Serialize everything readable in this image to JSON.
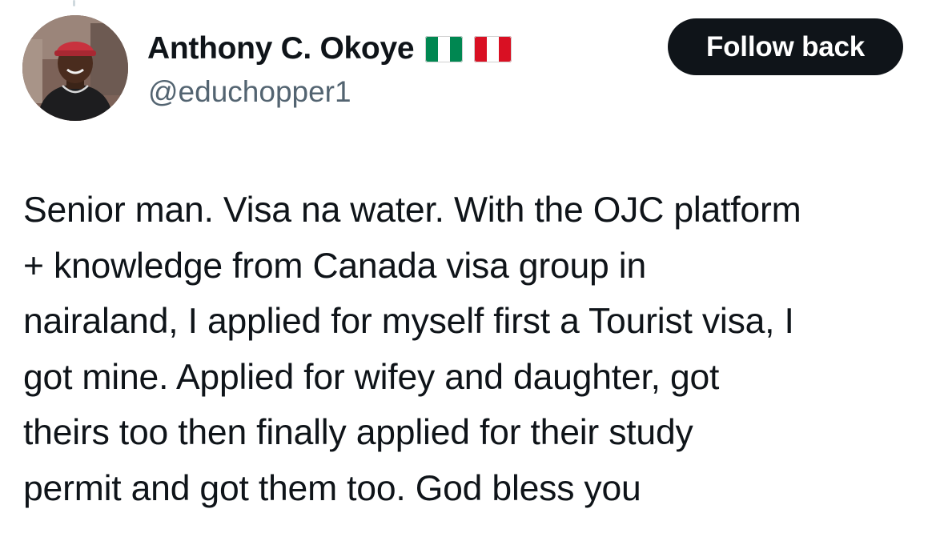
{
  "author": {
    "display_name": "Anthony C. Okoye",
    "handle": "@educhopper1",
    "flags": [
      {
        "icon": "nigeria-flag-icon",
        "colors": [
          "#008751",
          "#ffffff",
          "#008751"
        ]
      },
      {
        "icon": "peru-flag-icon",
        "colors": [
          "#d91023",
          "#ffffff",
          "#d91023"
        ]
      }
    ],
    "avatar_icon": "profile-photo"
  },
  "actions": {
    "follow_label": "Follow back"
  },
  "tweet": {
    "text": "Senior man. Visa na water. With the OJC platform\n+ knowledge from Canada visa group in\nnairaland, I applied for myself first a Tourist visa, I\ngot mine. Applied for wifey and daughter, got\ntheirs too then finally applied for their study\npermit and got them too. God bless you"
  },
  "colors": {
    "text_primary": "#0f1419",
    "text_secondary": "#536471",
    "button_bg": "#0f1419",
    "button_text": "#ffffff"
  }
}
